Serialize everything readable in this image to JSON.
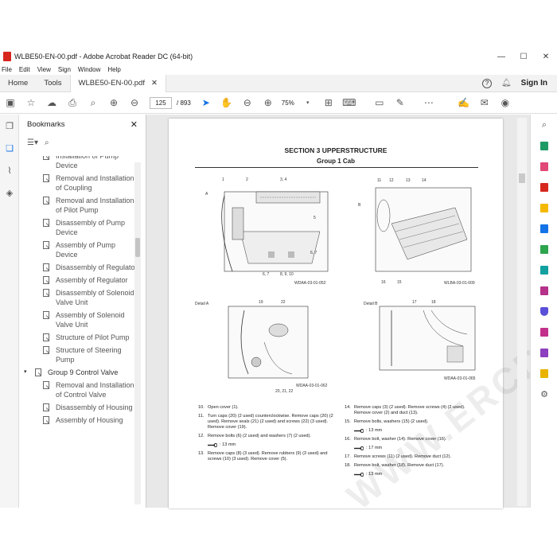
{
  "window": {
    "title": "WLBE50-EN-00.pdf - Adobe Acrobat Reader DC (64-bit)"
  },
  "menu": [
    "File",
    "Edit",
    "View",
    "Sign",
    "Window",
    "Help"
  ],
  "tabs": {
    "home": "Home",
    "tools": "Tools",
    "doc": "WLBE50-EN-00.pdf",
    "sign_in": "Sign In"
  },
  "toolbar": {
    "page_current": "125",
    "page_total": "/ 893",
    "zoom": "75%"
  },
  "bookmarks": {
    "title": "Bookmarks",
    "items": [
      {
        "label": "Installation of Pump Device",
        "level": "child"
      },
      {
        "label": "Removal and Installation of Coupling",
        "level": "child"
      },
      {
        "label": "Removal and Installation of Pilot Pump",
        "level": "child"
      },
      {
        "label": "Disassembly of Pump Device",
        "level": "child"
      },
      {
        "label": "Assembly of Pump Device",
        "level": "child"
      },
      {
        "label": "Disassembly of Regulator",
        "level": "child"
      },
      {
        "label": "Assembly of Regulator",
        "level": "child"
      },
      {
        "label": "Disassembly of Solenoid Valve Unit",
        "level": "child"
      },
      {
        "label": "Assembly of Solenoid Valve Unit",
        "level": "child"
      },
      {
        "label": "Structure of Pilot Pump",
        "level": "child"
      },
      {
        "label": "Structure of Steering Pump",
        "level": "child"
      },
      {
        "label": "Group 9 Control Valve",
        "level": "group"
      },
      {
        "label": "Removal and Installation of Control Valve",
        "level": "child"
      },
      {
        "label": "Disassembly of Housing",
        "level": "child"
      },
      {
        "label": "Assembly of Housing",
        "level": "child"
      }
    ]
  },
  "page": {
    "section": "SECTION 3 UPPERSTRUCTURE",
    "group": "Group 1 Cab",
    "fig1_ref": "WDAA-03-01-052",
    "fig2_ref": "WLBA-03-01-009",
    "fig3_label": "Detail A",
    "fig3_ref": "WDAA-03-01-062",
    "fig4_label": "Detail B",
    "fig4_ref": "WDAA-03-01-065",
    "fig1_callouts": [
      "1",
      "2",
      "3, 4",
      "5",
      "6, 7",
      "6, 7",
      "8, 9, 10",
      "A"
    ],
    "fig2_callouts": [
      "11",
      "12",
      "13",
      "14",
      "B",
      "16",
      "15"
    ],
    "fig3_callouts": [
      "19",
      "22",
      "20, 21, 22"
    ],
    "fig4_callouts": [
      "17",
      "18"
    ],
    "left_steps": [
      {
        "n": "10.",
        "t": "Open cover (1)."
      },
      {
        "n": "11.",
        "t": "Turn caps (20) (2 used) counterclockwise. Remove caps (20) (2 used). Remove seals (21) (2 used) and screws (22) (3 used). Remove cover (19)."
      },
      {
        "n": "12.",
        "t": "Remove bolts (6) (2 used) and washers (7) (2 used)."
      },
      {
        "n": "",
        "t": ": 13 mm",
        "wrench": true
      },
      {
        "n": "13.",
        "t": "Remove caps (8) (3 used). Remove rubbers (9) (3 used) and screws (10) (3 used). Remove cover (5)."
      }
    ],
    "right_steps": [
      {
        "n": "14.",
        "t": "Remove caps (3) (2 used). Remove screws (4) (2 used). Remove cover (2) and duct (13)."
      },
      {
        "n": "15.",
        "t": "Remove bolts, washers (15) (2 used)."
      },
      {
        "n": "",
        "t": ": 13 mm",
        "wrench": true
      },
      {
        "n": "16.",
        "t": "Remove bolt, washer (14). Remove cover (16)."
      },
      {
        "n": "",
        "t": ": 17 mm",
        "wrench": true
      },
      {
        "n": "17.",
        "t": "Remove screws (11) (2 used). Remove duct (12)."
      },
      {
        "n": "18.",
        "t": "Remove bolt, washer (18). Remove duct (17)."
      },
      {
        "n": "",
        "t": ": 13 mm",
        "wrench": true
      }
    ]
  },
  "watermark": "WWW.ERCDEPO.COM",
  "colors": {
    "accent": "#1473e6",
    "pdf_red": "#d7261e"
  }
}
